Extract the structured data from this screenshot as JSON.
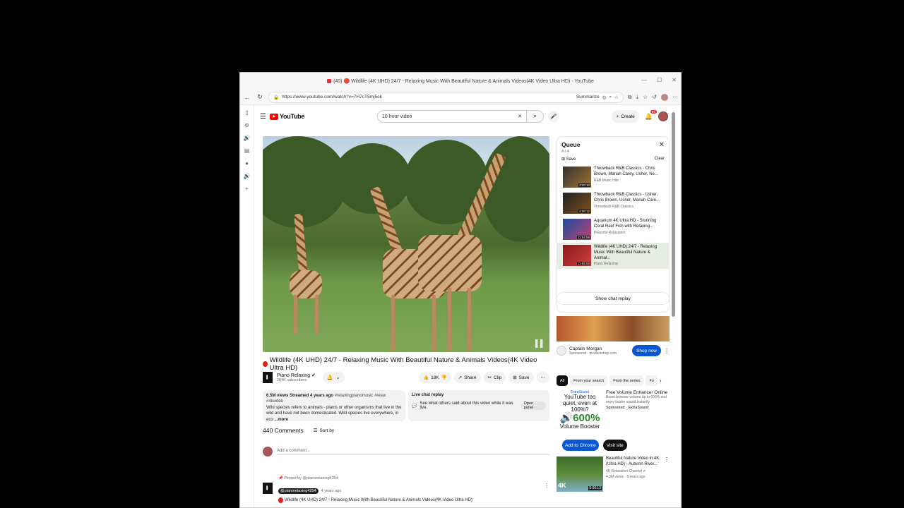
{
  "window": {
    "title": "(40) 🔴 Wildlife (4K UHD) 24/7 - Relaxing Music With Beautiful Nature & Animals Videos(4K Video Ultra HD) - YouTube",
    "minimize": "—",
    "maximize": "☐",
    "close": "✕"
  },
  "browser": {
    "url": "https://www.youtube.com/watch?v=7H7cT5mj5ok",
    "summarize": "Summarize"
  },
  "header": {
    "logo": "YouTube",
    "search_value": "10 hour video",
    "create": "Create",
    "notif_count": "9+"
  },
  "video": {
    "title": "Wildlife (4K UHD) 24/7 - Relaxing Music With Beautiful Nature & Animals Videos(4K Video Ultra HD)",
    "channel": "Piano Relaxing",
    "subscribers": "284K subscribers",
    "likes": "18K",
    "share": "Share",
    "clip": "Clip",
    "save": "Save"
  },
  "description": {
    "meta": "6.5M views  Streamed 4 years ago",
    "tags": "#relaxingpianomusic #relax #4kvideo",
    "text": "Wild species refers to animals - plants or other organisms that live in the wild and have not been domesticated. Wild species live everywhere, in eco",
    "more": "...more"
  },
  "live_chat": {
    "title": "Live chat replay",
    "text": "See what others said about this video while it was live.",
    "open": "Open panel"
  },
  "comments": {
    "count": "440 Comments",
    "sort": "Sort by",
    "placeholder": "Add a comment...",
    "pinned_label": "Pinned by @pianorelaxing4254",
    "author": "@pianorelaxing4254",
    "ago": "4 years ago",
    "text": "Wildlife (4K UHD) 24/7 - Relaxing Music With Beautiful Nature & Animals Videos(4K Video Ultra HD)"
  },
  "queue": {
    "title": "Queue",
    "count": "4 / 4",
    "save": "Save",
    "clear": "Clear",
    "items": [
      {
        "title": "Throwback R&B Classics - Chris Brown, Mariah Carey, Usher, Ne...",
        "channel": "R&B Music Hits",
        "duration": "3:20:10"
      },
      {
        "title": "Throwback R&B Classics - Usher, Chris Brown, Usher, Mariah Care...",
        "channel": "Throwback R&B Classics",
        "duration": "2:08:12"
      },
      {
        "title": "Aquarium 4K Ultra HD - Stunning Coral Reef Fish with Relaxing...",
        "channel": "Peaceful Relaxation",
        "duration": "11:54:58"
      },
      {
        "title": "Wildlife (4K UHD) 24/7 - Relaxing Music With Beautiful Nature & Animal...",
        "channel": "Piano Relaxing",
        "duration": "11:55:00"
      }
    ]
  },
  "chat_replay": "Show chat replay",
  "ad": {
    "name": "Captain Morgan",
    "sponsored": "Sponsored · productshop.com",
    "cta": "Shop now"
  },
  "chips": [
    "All",
    "From your search",
    "From the series",
    "Fo"
  ],
  "promo": {
    "brand": "ExtraSound",
    "headline": "YouTube too quiet, even at 100%?",
    "percent": "600%",
    "product": "Volume Booster",
    "title": "Free Volume Enhancer Online",
    "desc": "Boost browser volume up to 600% and enjoy louder sound instantly",
    "sponsored": "Sponsored · ExtraSound",
    "add": "Add to Chrome",
    "visit": "Visit site"
  },
  "rec": {
    "title": "Beautiful Nature Video in 4K (Ultra HD) - Autumn River...",
    "channel": "4K Relaxation Channel",
    "meta": "4.3M views · 5 years ago",
    "duration": "5:00:13",
    "badge": "4K"
  },
  "colors": {
    "accent": "#0b57d0",
    "yt_red": "#ff0000",
    "active_queue": "#e6ede2"
  }
}
